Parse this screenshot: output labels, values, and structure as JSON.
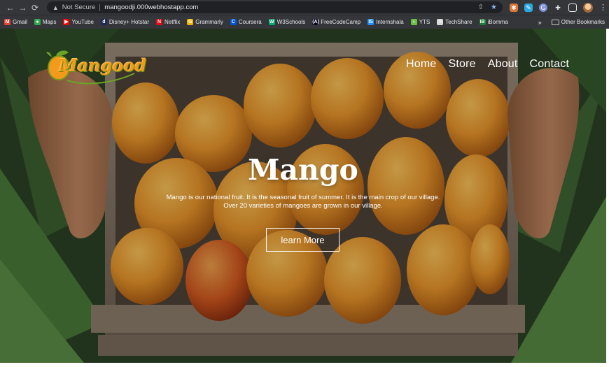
{
  "browser": {
    "security_label": "Not Secure",
    "url": "mangoodji.000webhostapp.com",
    "bookmarks": [
      {
        "label": "Gmail",
        "color": "#ea4335",
        "glyph": "M"
      },
      {
        "label": "Maps",
        "color": "#34a853",
        "glyph": "●"
      },
      {
        "label": "YouTube",
        "color": "#ff0000",
        "glyph": "▶"
      },
      {
        "label": "Disney+ Hotstar",
        "color": "#1f2a5a",
        "glyph": "d"
      },
      {
        "label": "Netflix",
        "color": "#e50914",
        "glyph": "N"
      },
      {
        "label": "Grammarly",
        "color": "#f0b400",
        "glyph": "G"
      },
      {
        "label": "Coursera",
        "color": "#0056d2",
        "glyph": "C"
      },
      {
        "label": "W3Schools",
        "color": "#04aa6d",
        "glyph": "W"
      },
      {
        "label": "FreeCodeCamp",
        "color": "#0a0a23",
        "glyph": "(A)"
      },
      {
        "label": "Internshala",
        "color": "#1a8cff",
        "glyph": "IS"
      },
      {
        "label": "YTS",
        "color": "#6ac045",
        "glyph": "◗"
      },
      {
        "label": "TechShare",
        "color": "#d8d8d8",
        "glyph": "≡"
      },
      {
        "label": "iBomma",
        "color": "#1b7f3a",
        "glyph": "iB"
      }
    ],
    "bookmarks_overflow": "»",
    "other_bookmarks": "Other Bookmarks"
  },
  "site": {
    "logo_text": "Mangood",
    "nav": [
      "Home",
      "Store",
      "About",
      "Contact"
    ],
    "hero_title": "Mango",
    "hero_desc_line1": "Mango is our national fruit. It is the seasonal fruit of summer. It is the main crop of our village.",
    "hero_desc_line2": "Over 20 varieties of mangoes are grown in our village.",
    "cta_label": "learn More"
  },
  "colors": {
    "accent_orange": "#f39a1b",
    "leaf_green": "#2f5a24",
    "chrome_dark": "#35363a"
  }
}
